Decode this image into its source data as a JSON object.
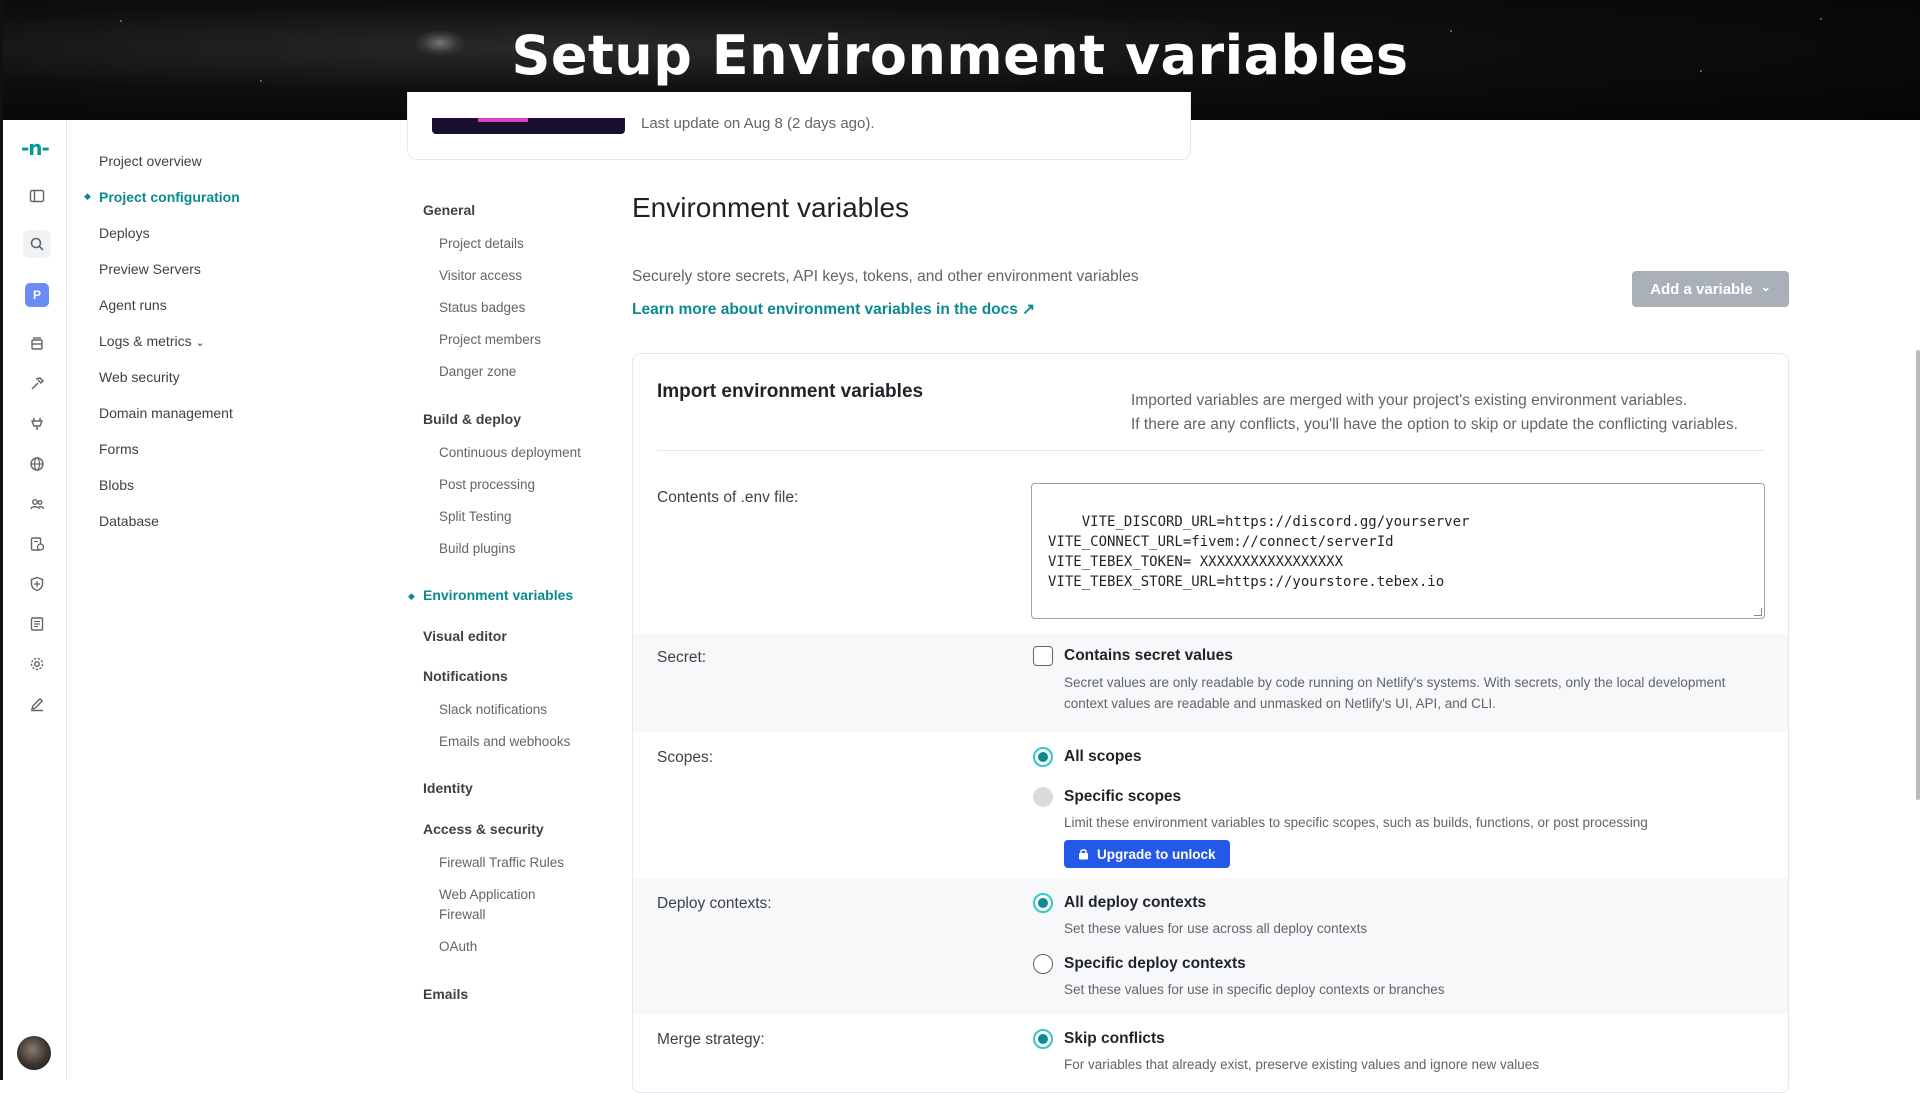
{
  "banner": {
    "title": "Setup Environment variables"
  },
  "top_card": {
    "last_update": "Last update on Aug 8 (2 days ago)."
  },
  "rail": {
    "logo": "-n-",
    "project_initial": "P",
    "icons": [
      "sidebar-toggle-icon",
      "search-icon",
      "project-icon",
      "layers-icon",
      "hammer-icon",
      "plug-icon",
      "globe-icon",
      "users-icon",
      "file-check-icon",
      "shield-icon",
      "book-icon",
      "gear-icon",
      "pencil-icon"
    ]
  },
  "nav1": {
    "items": [
      "Project overview",
      "Project configuration",
      "Deploys",
      "Preview Servers",
      "Agent runs",
      "Logs & metrics",
      "Web security",
      "Domain management",
      "Forms",
      "Blobs",
      "Database"
    ],
    "logs_chevron": "⌄"
  },
  "nav2": {
    "general": {
      "heading": "General",
      "items": [
        "Project details",
        "Visitor access",
        "Status badges",
        "Project members",
        "Danger zone"
      ]
    },
    "build": {
      "heading": "Build & deploy",
      "items": [
        "Continuous deployment",
        "Post processing",
        "Split Testing",
        "Build plugins"
      ]
    },
    "env": {
      "heading": "Environment variables"
    },
    "visual": {
      "heading": "Visual editor"
    },
    "notifications": {
      "heading": "Notifications",
      "items": [
        "Slack notifications",
        "Emails and webhooks"
      ]
    },
    "identity": {
      "heading": "Identity"
    },
    "access": {
      "heading": "Access & security",
      "items": [
        "Firewall Traffic Rules",
        "Web Application",
        "Firewall",
        "OAuth"
      ]
    },
    "emails": {
      "heading": "Emails"
    }
  },
  "main": {
    "title": "Environment variables",
    "description": "Securely store secrets, API keys, tokens, and other environment variables",
    "docs_link": "Learn more about environment variables in the docs ↗",
    "add_variable": "Add a variable",
    "add_chevron": "⌄"
  },
  "import_panel": {
    "title": "Import environment variables",
    "note_line1": "Imported variables are merged with your project's existing environment variables.",
    "note_line2": "If there are any conflicts, you'll have the option to skip or update the conflicting variables.",
    "env_label": "Contents of .env file:",
    "env_contents": "VITE_DISCORD_URL=https://discord.gg/yourserver\nVITE_CONNECT_URL=fivem://connect/serverId\nVITE_TEBEX_TOKEN= XXXXXXXXXXXXXXXXX\nVITE_TEBEX_STORE_URL=https://yourstore.tebex.io",
    "secret": {
      "label": "Secret:",
      "checkbox_label": "Contains secret values",
      "checked": false,
      "desc_line1": "Secret values are only readable by code running on Netlify's systems. With secrets, only the local development",
      "desc_line2": "context values are readable and unmasked on Netlify's UI, API, and CLI."
    },
    "scopes": {
      "label": "Scopes:",
      "all": "All scopes",
      "specific": "Specific scopes",
      "specific_desc": "Limit these environment variables to specific scopes, such as builds, functions, or post processing",
      "upgrade": "Upgrade to unlock",
      "selected": "All scopes"
    },
    "contexts": {
      "label": "Deploy contexts:",
      "all": "All deploy contexts",
      "all_desc": "Set these values for use across all deploy contexts",
      "specific": "Specific deploy contexts",
      "specific_desc": "Set these values for use in specific deploy contexts or branches",
      "selected": "All deploy contexts"
    },
    "merge": {
      "label": "Merge strategy:",
      "skip": "Skip conflicts",
      "skip_desc": "For variables that already exist, preserve existing values and ignore new values",
      "selected": "Skip conflicts"
    }
  },
  "colors": {
    "accent": "#0b8a8f",
    "radio_ring": "#30c8c9",
    "upgrade": "#2458e6",
    "add_button_disabled": "#a9b0b7"
  }
}
